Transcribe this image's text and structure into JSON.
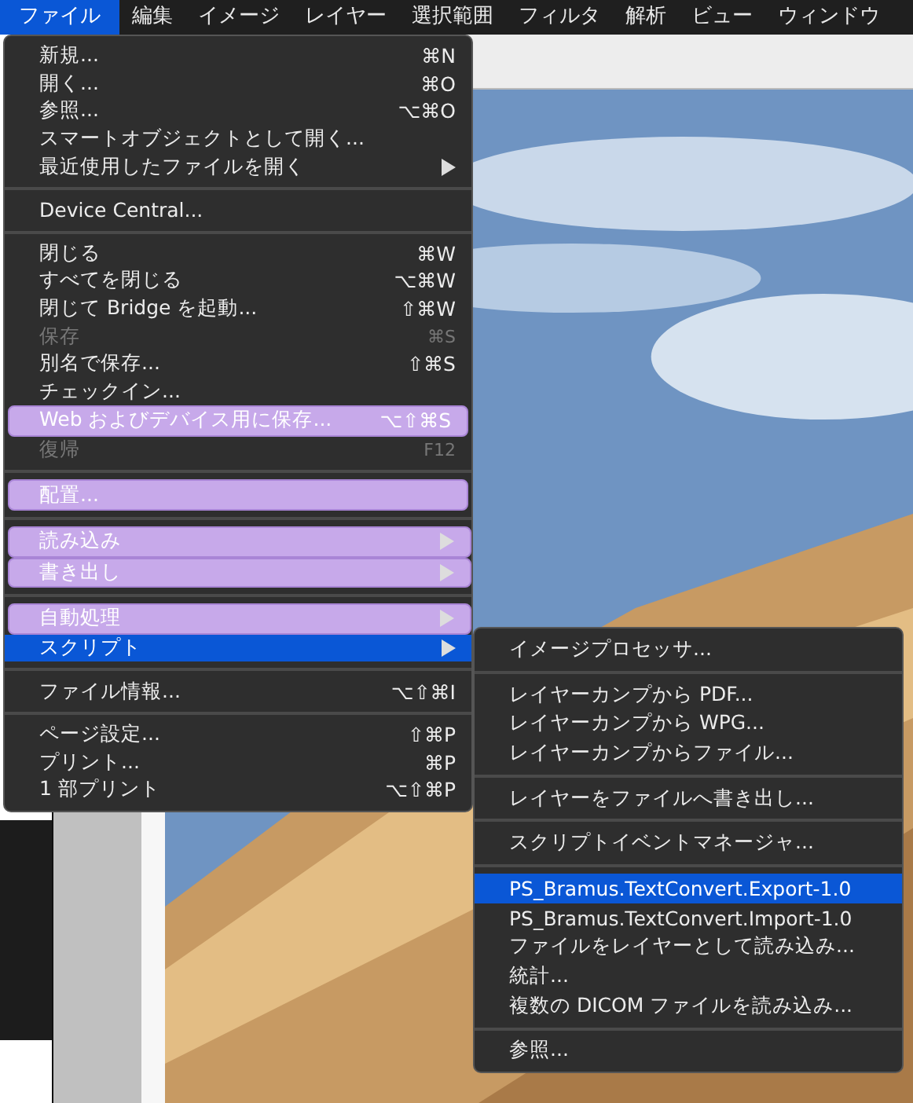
{
  "menubar": [
    {
      "label": "ファイル",
      "selected": true
    },
    {
      "label": "編集",
      "selected": false
    },
    {
      "label": "イメージ",
      "selected": false
    },
    {
      "label": "レイヤー",
      "selected": false
    },
    {
      "label": "選択範囲",
      "selected": false
    },
    {
      "label": "フィルタ",
      "selected": false
    },
    {
      "label": "解析",
      "selected": false
    },
    {
      "label": "ビュー",
      "selected": false
    },
    {
      "label": "ウィンドウ",
      "selected": false
    }
  ],
  "file_menu": {
    "items": [
      {
        "kind": "item",
        "label": "新規...",
        "shortcut": "⌘N",
        "disabled": false,
        "highlighted": false,
        "selected": false,
        "submenu": false
      },
      {
        "kind": "item",
        "label": "開く...",
        "shortcut": "⌘O",
        "disabled": false,
        "highlighted": false,
        "selected": false,
        "submenu": false
      },
      {
        "kind": "item",
        "label": "参照...",
        "shortcut": "⌥⌘O",
        "disabled": false,
        "highlighted": false,
        "selected": false,
        "submenu": false
      },
      {
        "kind": "item",
        "label": "スマートオブジェクトとして開く...",
        "disabled": false,
        "highlighted": false,
        "selected": false,
        "submenu": false
      },
      {
        "kind": "item",
        "label": "最近使用したファイルを開く",
        "disabled": false,
        "highlighted": false,
        "selected": false,
        "submenu": true
      },
      {
        "kind": "separator"
      },
      {
        "kind": "item",
        "label": "Device Central...",
        "disabled": false,
        "highlighted": false,
        "selected": false,
        "submenu": false
      },
      {
        "kind": "separator"
      },
      {
        "kind": "item",
        "label": "閉じる",
        "shortcut": "⌘W",
        "disabled": false,
        "highlighted": false,
        "selected": false,
        "submenu": false
      },
      {
        "kind": "item",
        "label": "すべてを閉じる",
        "shortcut": "⌥⌘W",
        "disabled": false,
        "highlighted": false,
        "selected": false,
        "submenu": false
      },
      {
        "kind": "item",
        "label": "閉じて Bridge を起動...",
        "shortcut": "⇧⌘W",
        "disabled": false,
        "highlighted": false,
        "selected": false,
        "submenu": false
      },
      {
        "kind": "item",
        "label": "保存",
        "shortcut": "⌘S",
        "disabled": true,
        "highlighted": false,
        "selected": false,
        "submenu": false
      },
      {
        "kind": "item",
        "label": "別名で保存...",
        "shortcut": "⇧⌘S",
        "disabled": false,
        "highlighted": false,
        "selected": false,
        "submenu": false
      },
      {
        "kind": "item",
        "label": "チェックイン...",
        "disabled": false,
        "highlighted": false,
        "selected": false,
        "submenu": false
      },
      {
        "kind": "item",
        "label": "Web およびデバイス用に保存...",
        "shortcut": "⌥⇧⌘S",
        "disabled": false,
        "highlighted": true,
        "selected": false,
        "submenu": false
      },
      {
        "kind": "item",
        "label": "復帰",
        "shortcut": "F12",
        "disabled": true,
        "highlighted": false,
        "selected": false,
        "submenu": false
      },
      {
        "kind": "separator"
      },
      {
        "kind": "item",
        "label": "配置...",
        "disabled": false,
        "highlighted": true,
        "selected": false,
        "submenu": false
      },
      {
        "kind": "separator"
      },
      {
        "kind": "item",
        "label": "読み込み",
        "disabled": false,
        "highlighted": true,
        "selected": false,
        "submenu": true
      },
      {
        "kind": "item",
        "label": "書き出し",
        "disabled": false,
        "highlighted": true,
        "selected": false,
        "submenu": true
      },
      {
        "kind": "separator"
      },
      {
        "kind": "item",
        "label": "自動処理",
        "disabled": false,
        "highlighted": true,
        "selected": false,
        "submenu": true
      },
      {
        "kind": "item",
        "label": "スクリプト",
        "disabled": false,
        "highlighted": false,
        "selected": true,
        "submenu": true
      },
      {
        "kind": "separator"
      },
      {
        "kind": "item",
        "label": "ファイル情報...",
        "shortcut": "⌥⇧⌘I",
        "disabled": false,
        "highlighted": false,
        "selected": false,
        "submenu": false
      },
      {
        "kind": "separator"
      },
      {
        "kind": "item",
        "label": "ページ設定...",
        "shortcut": "⇧⌘P",
        "disabled": false,
        "highlighted": false,
        "selected": false,
        "submenu": false
      },
      {
        "kind": "item",
        "label": "プリント...",
        "shortcut": "⌘P",
        "disabled": false,
        "highlighted": false,
        "selected": false,
        "submenu": false
      },
      {
        "kind": "item",
        "label": "1 部プリント",
        "shortcut": "⌥⇧⌘P",
        "disabled": false,
        "highlighted": false,
        "selected": false,
        "submenu": false
      }
    ]
  },
  "script_submenu": {
    "items": [
      {
        "kind": "item",
        "label": "イメージプロセッサ...",
        "selected": false
      },
      {
        "kind": "separator"
      },
      {
        "kind": "item",
        "label": "レイヤーカンプから PDF...",
        "selected": false
      },
      {
        "kind": "item",
        "label": "レイヤーカンプから WPG...",
        "selected": false
      },
      {
        "kind": "item",
        "label": "レイヤーカンプからファイル...",
        "selected": false
      },
      {
        "kind": "separator"
      },
      {
        "kind": "item",
        "label": "レイヤーをファイルへ書き出し...",
        "selected": false
      },
      {
        "kind": "separator"
      },
      {
        "kind": "item",
        "label": "スクリプトイベントマネージャ...",
        "selected": false
      },
      {
        "kind": "separator"
      },
      {
        "kind": "item",
        "label": "PS_Bramus.TextConvert.Export-1.0",
        "selected": true
      },
      {
        "kind": "item",
        "label": "PS_Bramus.TextConvert.Import-1.0",
        "selected": false
      },
      {
        "kind": "item",
        "label": "ファイルをレイヤーとして読み込み...",
        "selected": false
      },
      {
        "kind": "item",
        "label": "統計...",
        "selected": false
      },
      {
        "kind": "item",
        "label": "複数の DICOM ファイルを読み込み...",
        "selected": false
      },
      {
        "kind": "separator"
      },
      {
        "kind": "item",
        "label": "参照...",
        "selected": false
      }
    ]
  }
}
